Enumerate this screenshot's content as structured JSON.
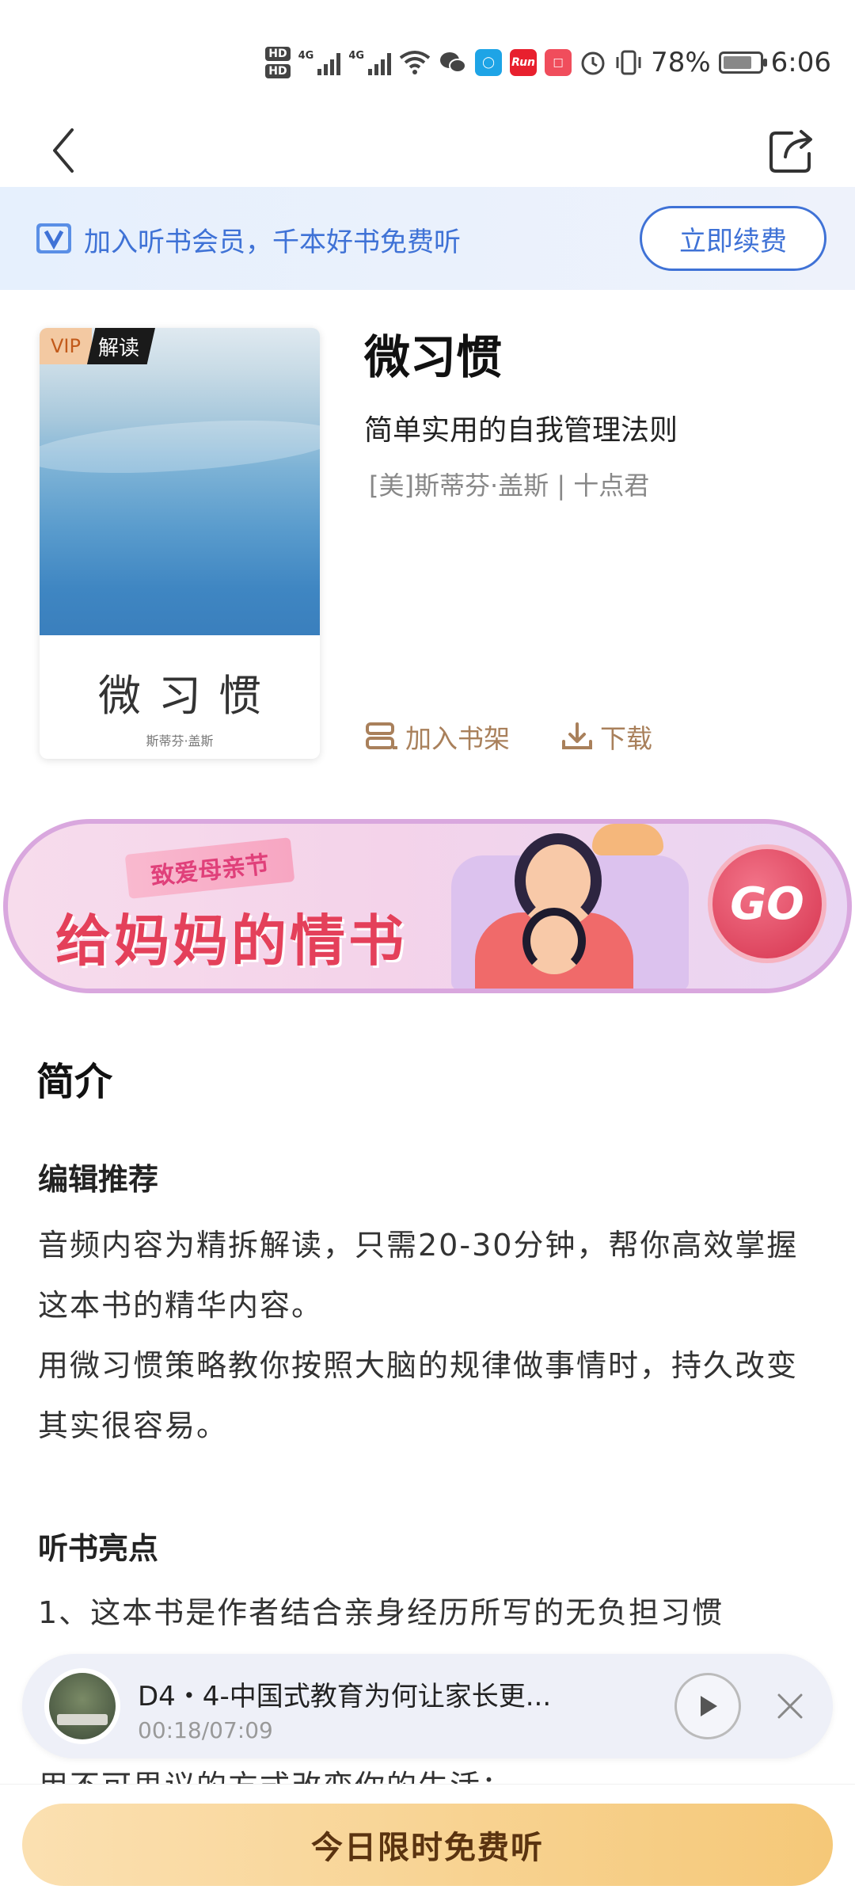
{
  "status_bar": {
    "hd1": "HD",
    "hd2": "HD",
    "net1": "4G",
    "net2": "4G",
    "app_run": "Run",
    "battery": "78%",
    "time": "6:06"
  },
  "vip_banner": {
    "text": "加入听书会员，千本好书免费听",
    "button": "立即续费"
  },
  "book": {
    "badge_vip": "VIP",
    "badge_type": "解读",
    "cover_title": "微习惯",
    "cover_author": "斯蒂芬·盖斯",
    "title": "微习惯",
    "subtitle": "简单实用的自我管理法则",
    "author": "[美]斯蒂芬·盖斯 | 十点君",
    "add_shelf": "加入书架",
    "download": "下载"
  },
  "promo": {
    "ribbon": "致爱母亲节",
    "title": "给妈妈的情书",
    "go": "GO"
  },
  "intro": {
    "section_title": "简介",
    "editor_heading": "编辑推荐",
    "editor_para1": "音频内容为精拆解读，只需20-30分钟，帮你高效掌握这本书的精华内容。",
    "editor_para2": "用微习惯策略教你按照大脑的规律做事情时，持久改变其实很容易。",
    "highlights_heading": "听书亮点",
    "highlights_item1": "1、这本书是作者结合亲身经历所写的无负担习惯",
    "peek_line": "用不可思议的方式改变你的生活；"
  },
  "player": {
    "title": "D4・4-中国式教育为何让家长更...",
    "time": "00:18/07:09"
  },
  "cta": {
    "label": "今日限时免费听"
  },
  "colors": {
    "accent_blue": "#3f72d6",
    "action_brown": "#a9805b",
    "cta_gold": "#f5c878"
  }
}
